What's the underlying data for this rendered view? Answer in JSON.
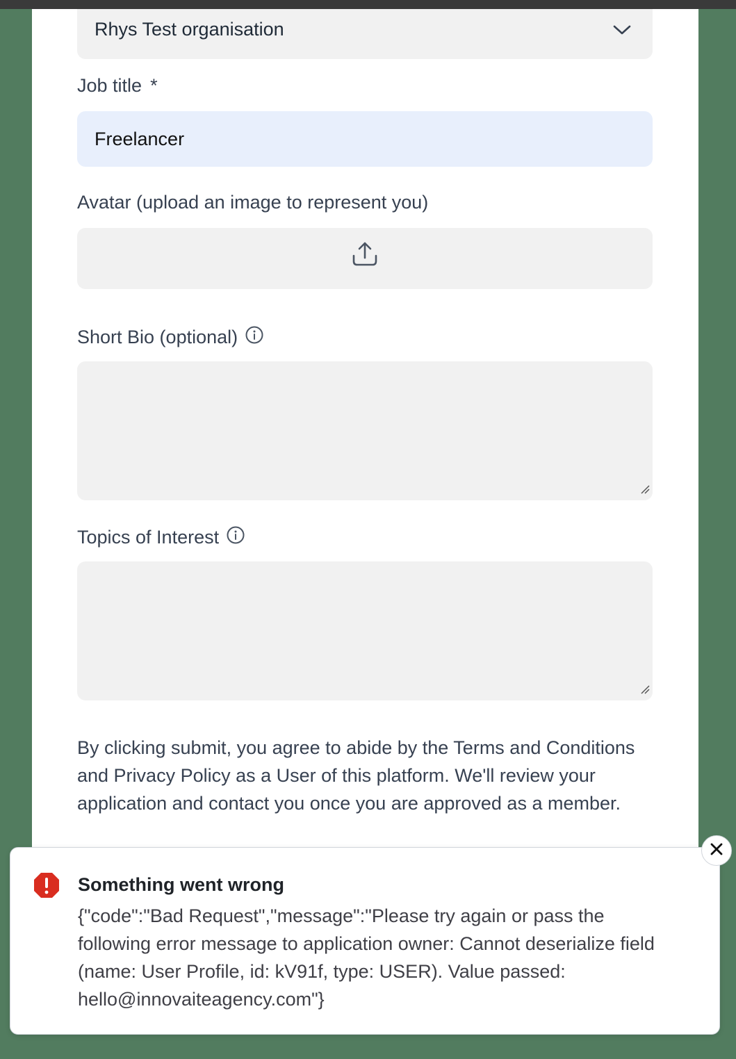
{
  "organisation_select": {
    "value": "Rhys Test organisation",
    "icon": "chevron-down-icon"
  },
  "job_title": {
    "label": "Job title",
    "required_mark": "*",
    "value": "Freelancer"
  },
  "avatar": {
    "label": "Avatar (upload an image to represent you)",
    "icon": "upload-icon"
  },
  "short_bio": {
    "label": "Short Bio (optional)",
    "value": "",
    "info_icon": "info-icon"
  },
  "topics": {
    "label": "Topics of Interest",
    "value": "",
    "info_icon": "info-icon"
  },
  "terms_text": "By clicking submit, you agree to abide by the Terms and Conditions and Privacy Policy as a User of this platform. We'll review your application and contact you once you are approved as a member.",
  "toast": {
    "title": "Something went wrong",
    "message": "{\"code\":\"Bad Request\",\"message\":\"Please try again or pass the following error message to application owner: Cannot deserialize field (name: User Profile, id: kV91f, type: USER). Value passed: hello@innovaiteagency.com\"}",
    "icon": "error-icon",
    "close_icon": "close-icon",
    "error_color": "#d92d20"
  },
  "colors": {
    "background": "#527c5f",
    "panel": "#ffffff",
    "field": "#f1f1f1",
    "input_filled": "#e8effc"
  }
}
